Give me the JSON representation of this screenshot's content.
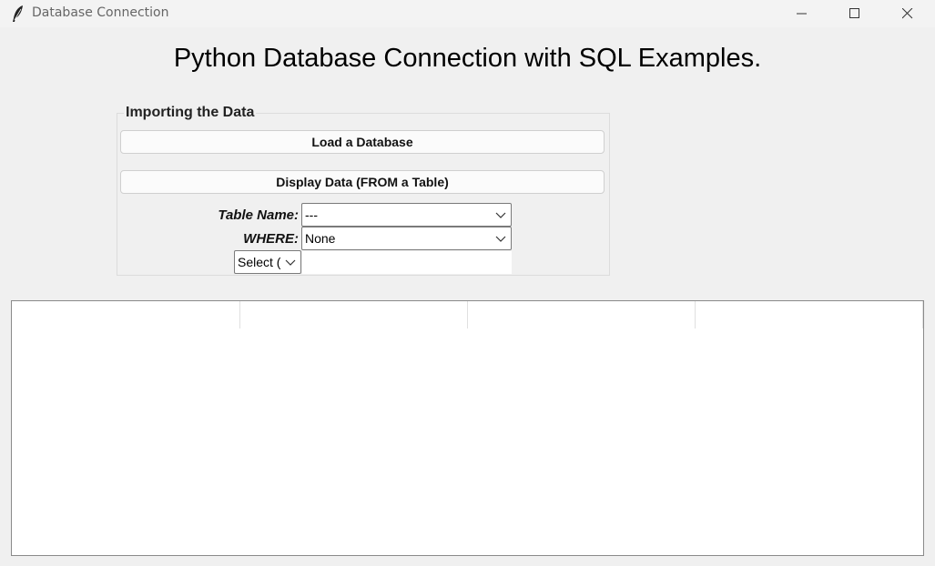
{
  "window": {
    "title": "Database Connection",
    "icon": "feather-icon"
  },
  "heading": "Python Database Connection with SQL Examples.",
  "import_group": {
    "label": "Importing the Data",
    "load_button": "Load a Database",
    "display_button": "Display Data (FROM a Table)",
    "table_name_label": "Table Name:",
    "table_name_value": "---",
    "where_label": "WHERE:",
    "where_value": "None",
    "select_value": "Select (",
    "entry_value": ""
  },
  "result_table": {
    "columns": [
      "",
      "",
      "",
      ""
    ]
  }
}
